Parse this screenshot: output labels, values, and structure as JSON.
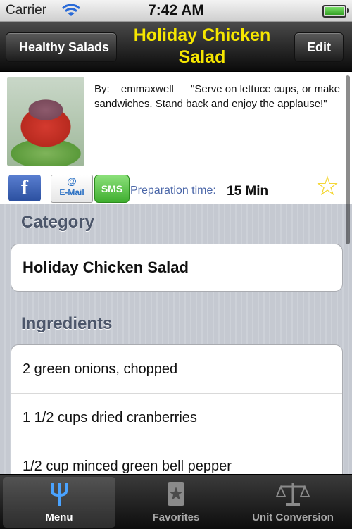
{
  "status_bar": {
    "carrier": "Carrier",
    "time": "7:42 AM"
  },
  "nav": {
    "back_label": "Healthy Salads",
    "title": "Holiday Chicken Salad",
    "edit_label": "Edit"
  },
  "recipe": {
    "by_label": "By:",
    "author": "emmaxwell",
    "description": "\"Serve on lettuce cups, or make sandwiches. Stand back and enjoy the applause!\"",
    "prep_label": "Preparation time:",
    "prep_value": "15 Min"
  },
  "share": {
    "facebook_label": "f",
    "email_label": "E-Mail",
    "email_at": "@",
    "sms_label": "SMS"
  },
  "sections": {
    "category_header": "Category",
    "category_value": "Holiday Chicken Salad",
    "ingredients_header": "Ingredients",
    "ingredients": [
      "2 green onions, chopped",
      "1 1/2 cups dried cranberries",
      "1/2 cup minced green bell pepper"
    ]
  },
  "tabbar": {
    "tabs": [
      {
        "label": "Menu",
        "selected": true
      },
      {
        "label": "Favorites",
        "selected": false
      },
      {
        "label": "Unit Conversion",
        "selected": false
      }
    ]
  },
  "colors": {
    "title_yellow": "#f6e600",
    "prep_label_blue": "#4a66a8",
    "tab_selected_icon": "#4aa3ff"
  }
}
